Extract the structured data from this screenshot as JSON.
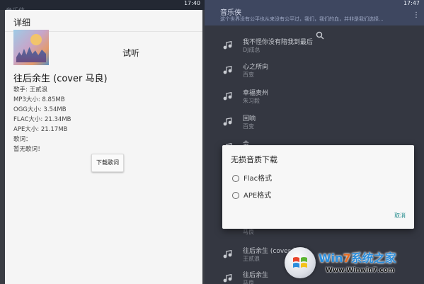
{
  "left_screen": {
    "status_time": "17:40",
    "dim_app_title": "音乐侠",
    "panel_title": "详细",
    "trial_label": "试听",
    "song_title": "往后余生 (cover 马良)",
    "info_lines": [
      "歌手: 王贰浪",
      "MP3大小: 8.85MB",
      "OGG大小: 3.54MB",
      "FLAC大小: 21.34MB",
      "APE大小: 21.17MB",
      "歌词：",
      "暂无歌词！"
    ],
    "download_lyrics_label": "下载歌词"
  },
  "right_screen": {
    "status_time": "17:47",
    "app_title": "音乐侠",
    "app_subtitle": "这个世界没有公平也从来没有公平过，我们，我们的血，并非是我们选择...",
    "menu_icon": "more-vert-icon",
    "search_icon": "search-icon",
    "songs": [
      {
        "title": "我不怪你没有陪我到最后",
        "artist": "DJ成总"
      },
      {
        "title": "心之所向",
        "artist": "百变"
      },
      {
        "title": "幸福责州",
        "artist": "朱习毅"
      },
      {
        "title": "回响",
        "artist": "百变"
      },
      {
        "title": "会",
        "artist": ""
      },
      {
        "title": "",
        "artist": ""
      },
      {
        "title": "",
        "artist": ""
      },
      {
        "title": "",
        "artist": "马良"
      },
      {
        "title": "往后余生 (cover 马良)",
        "artist": "王贰浪"
      },
      {
        "title": "往后余生",
        "artist": "马良"
      }
    ]
  },
  "dialog": {
    "title": "无损音质下载",
    "options": [
      "Flac格式",
      "APE格式"
    ],
    "cancel_label": "取消"
  },
  "watermark": {
    "brand_prefix": "Win",
    "brand_seven": "7",
    "brand_suffix": "系统之家",
    "url": "Www.Winwin7.com"
  },
  "colors": {
    "accent": "#2b8f90",
    "app_bar": "#3e4760",
    "panel_bg": "#f5f5f5"
  }
}
